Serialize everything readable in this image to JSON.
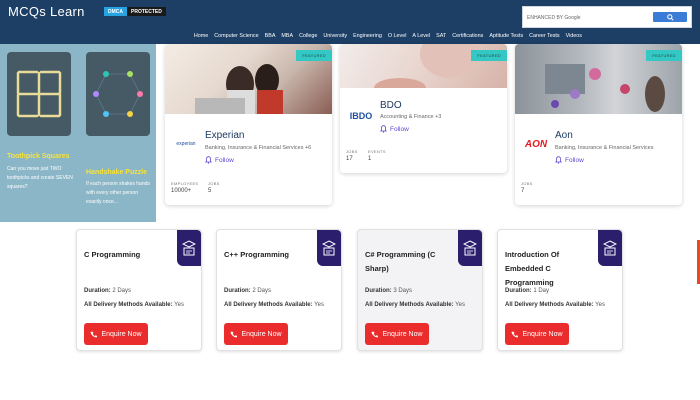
{
  "header": {
    "logo": "MCQs Learn",
    "badge_dmca": "DMCA",
    "badge_protected": "PROTECTED",
    "search_placeholder": "ENHANCED BY Google",
    "nav": [
      "Home",
      "Computer Science",
      "BBA",
      "MBA",
      "College",
      "University",
      "Engineering",
      "O Level",
      "A Level",
      "SAT",
      "Certifications",
      "Aptitude Tests",
      "Career Tests",
      "Videos"
    ]
  },
  "puzzles": [
    {
      "title": "Toothpick Squares",
      "desc": "Can you move just TWO toothpicks and create SEVEN squares?"
    },
    {
      "title": "Handshake Puzzle",
      "desc": "If each person shakes hands with every other person exactly once..."
    }
  ],
  "companies": [
    {
      "featured": "FEATURED",
      "name": "Experian",
      "industry": "Banking, Insurance & Financial Services +6",
      "follow": "Follow",
      "stat1_label": "EMPLOYEES",
      "stat1_value": "10000+",
      "stat2_label": "JOBS",
      "stat2_value": "5",
      "logo_text": "experian"
    },
    {
      "featured": "FEATURED",
      "name": "BDO",
      "industry": "Accounting & Finance +3",
      "follow": "Follow",
      "stat1_label": "JOBS",
      "stat1_value": "17",
      "stat2_label": "EVENTS",
      "stat2_value": "1",
      "logo_text": "IBDO"
    },
    {
      "featured": "FEATURED",
      "name": "Aon",
      "industry": "Banking, Insurance & Financial Services",
      "follow": "Follow",
      "stat1_label": "JOBS",
      "stat1_value": "7",
      "logo_text": "AON"
    }
  ],
  "courses": [
    {
      "title": "C Programming",
      "duration_label": "Duration:",
      "duration": "2 Days",
      "delivery_label": "All Delivery Methods Available:",
      "delivery": "Yes",
      "button": "Enquire Now"
    },
    {
      "title": "C++ Programming",
      "duration_label": "Duration:",
      "duration": "2 Days",
      "delivery_label": "All Delivery Methods Available:",
      "delivery": "Yes",
      "button": "Enquire Now"
    },
    {
      "title": "C# Programming (C Sharp)",
      "duration_label": "Duration:",
      "duration": "3 Days",
      "delivery_label": "All Delivery Methods Available:",
      "delivery": "Yes",
      "button": "Enquire Now"
    },
    {
      "title": "Introduction Of Embedded C Programming",
      "duration_label": "Duration:",
      "duration": "1 Day",
      "delivery_label": "All Delivery Methods Available:",
      "delivery": "Yes",
      "button": "Enquire Now"
    }
  ],
  "colors": {
    "header_bg": "#1d3f66",
    "puzzle_bg": "#8bb6c7",
    "featured": "#34c8c4",
    "follow": "#5b4bd1",
    "enquire": "#ea2c2c",
    "course_icon_bg": "#2b1e6d"
  },
  "icons": {
    "search": "search-icon",
    "bell": "bell-icon",
    "phone": "phone-icon",
    "course": "graduation-cap-icon"
  }
}
